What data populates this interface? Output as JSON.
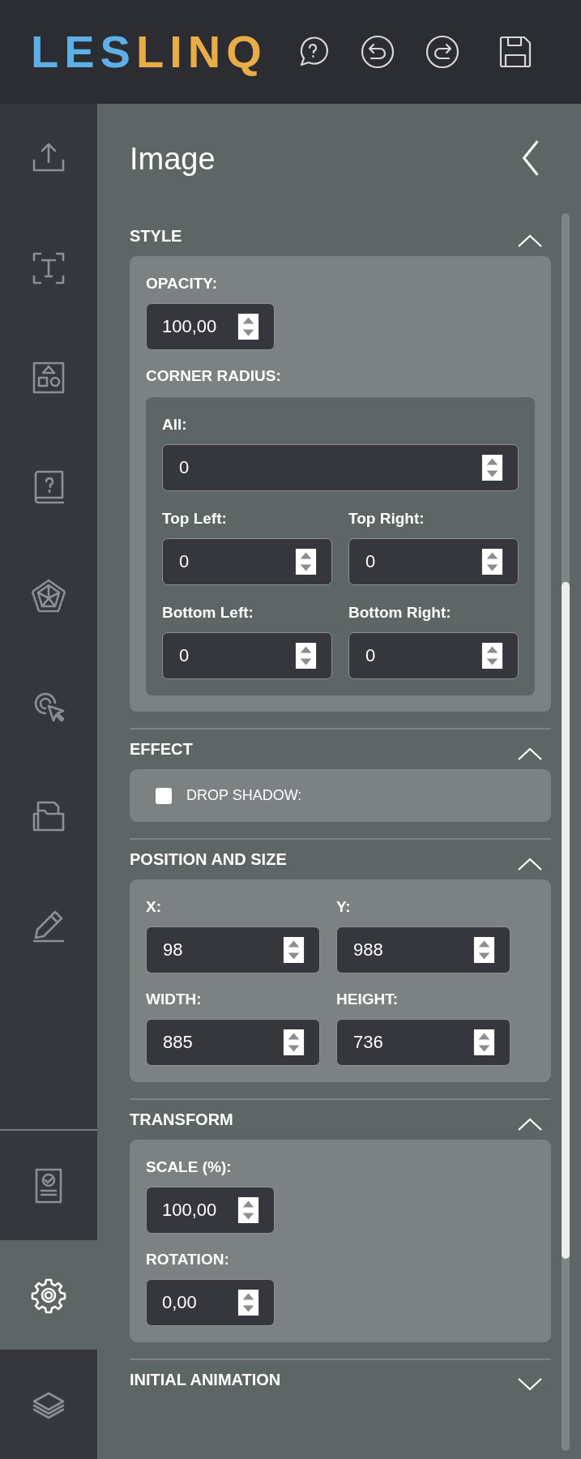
{
  "logo": [
    {
      "text": "LES",
      "color": "#5cb0e6"
    },
    {
      "text": "LINQ",
      "color": "#e9ad45"
    }
  ],
  "toolbar": [
    {
      "kind": "help"
    },
    {
      "kind": "undo"
    },
    {
      "kind": "redo"
    },
    {
      "kind": "save"
    }
  ],
  "sidebar": {
    "items": [
      {
        "kind": "upload",
        "selected": false
      },
      {
        "kind": "text",
        "selected": false
      },
      {
        "kind": "shapes",
        "selected": false
      },
      {
        "kind": "book",
        "selected": false
      },
      {
        "kind": "pentagon",
        "selected": false
      },
      {
        "kind": "cursor",
        "selected": false
      },
      {
        "kind": "folder",
        "selected": false
      },
      {
        "kind": "pencil",
        "selected": false
      }
    ],
    "bottom_items": [
      {
        "kind": "certificate",
        "selected": false
      },
      {
        "kind": "settings",
        "selected": true
      },
      {
        "kind": "layers",
        "selected": false
      }
    ]
  },
  "panel": {
    "title": "Image",
    "sections": [
      {
        "title": "STYLE",
        "expanded": true,
        "content": [
          {
            "kind": "field",
            "label": "OPACITY:",
            "value": "100,00"
          },
          {
            "kind": "group",
            "label": "CORNER RADIUS:",
            "items": [
              {
                "kind": "wide",
                "label": "All:",
                "value": "0"
              },
              {
                "kind": "pair",
                "fields": [
                  {
                    "label": "Top Left:",
                    "value": "0"
                  },
                  {
                    "label": "Top Right:",
                    "value": "0"
                  }
                ]
              },
              {
                "kind": "pair",
                "fields": [
                  {
                    "label": "Bottom Left:",
                    "value": "0"
                  },
                  {
                    "label": "Bottom Right:",
                    "value": "0"
                  }
                ]
              }
            ]
          }
        ]
      },
      {
        "title": "EFFECT",
        "expanded": true,
        "content": [
          {
            "kind": "checkbox",
            "label": "DROP SHADOW:",
            "checked": false
          }
        ]
      },
      {
        "title": "POSITION AND SIZE",
        "expanded": true,
        "content": [
          {
            "kind": "pair",
            "fields": [
              {
                "label": "X:",
                "value": "98"
              },
              {
                "label": "Y:",
                "value": "988"
              }
            ]
          },
          {
            "kind": "pair",
            "fields": [
              {
                "label": "WIDTH:",
                "value": "885"
              },
              {
                "label": "HEIGHT:",
                "value": "736"
              }
            ]
          }
        ]
      },
      {
        "title": "TRANSFORM",
        "expanded": true,
        "content": [
          {
            "kind": "field",
            "label": "SCALE (%):",
            "value": "100,00"
          },
          {
            "kind": "field",
            "label": "ROTATION:",
            "value": "0,00"
          }
        ]
      },
      {
        "title": "INITIAL ANIMATION",
        "expanded": false
      }
    ]
  }
}
